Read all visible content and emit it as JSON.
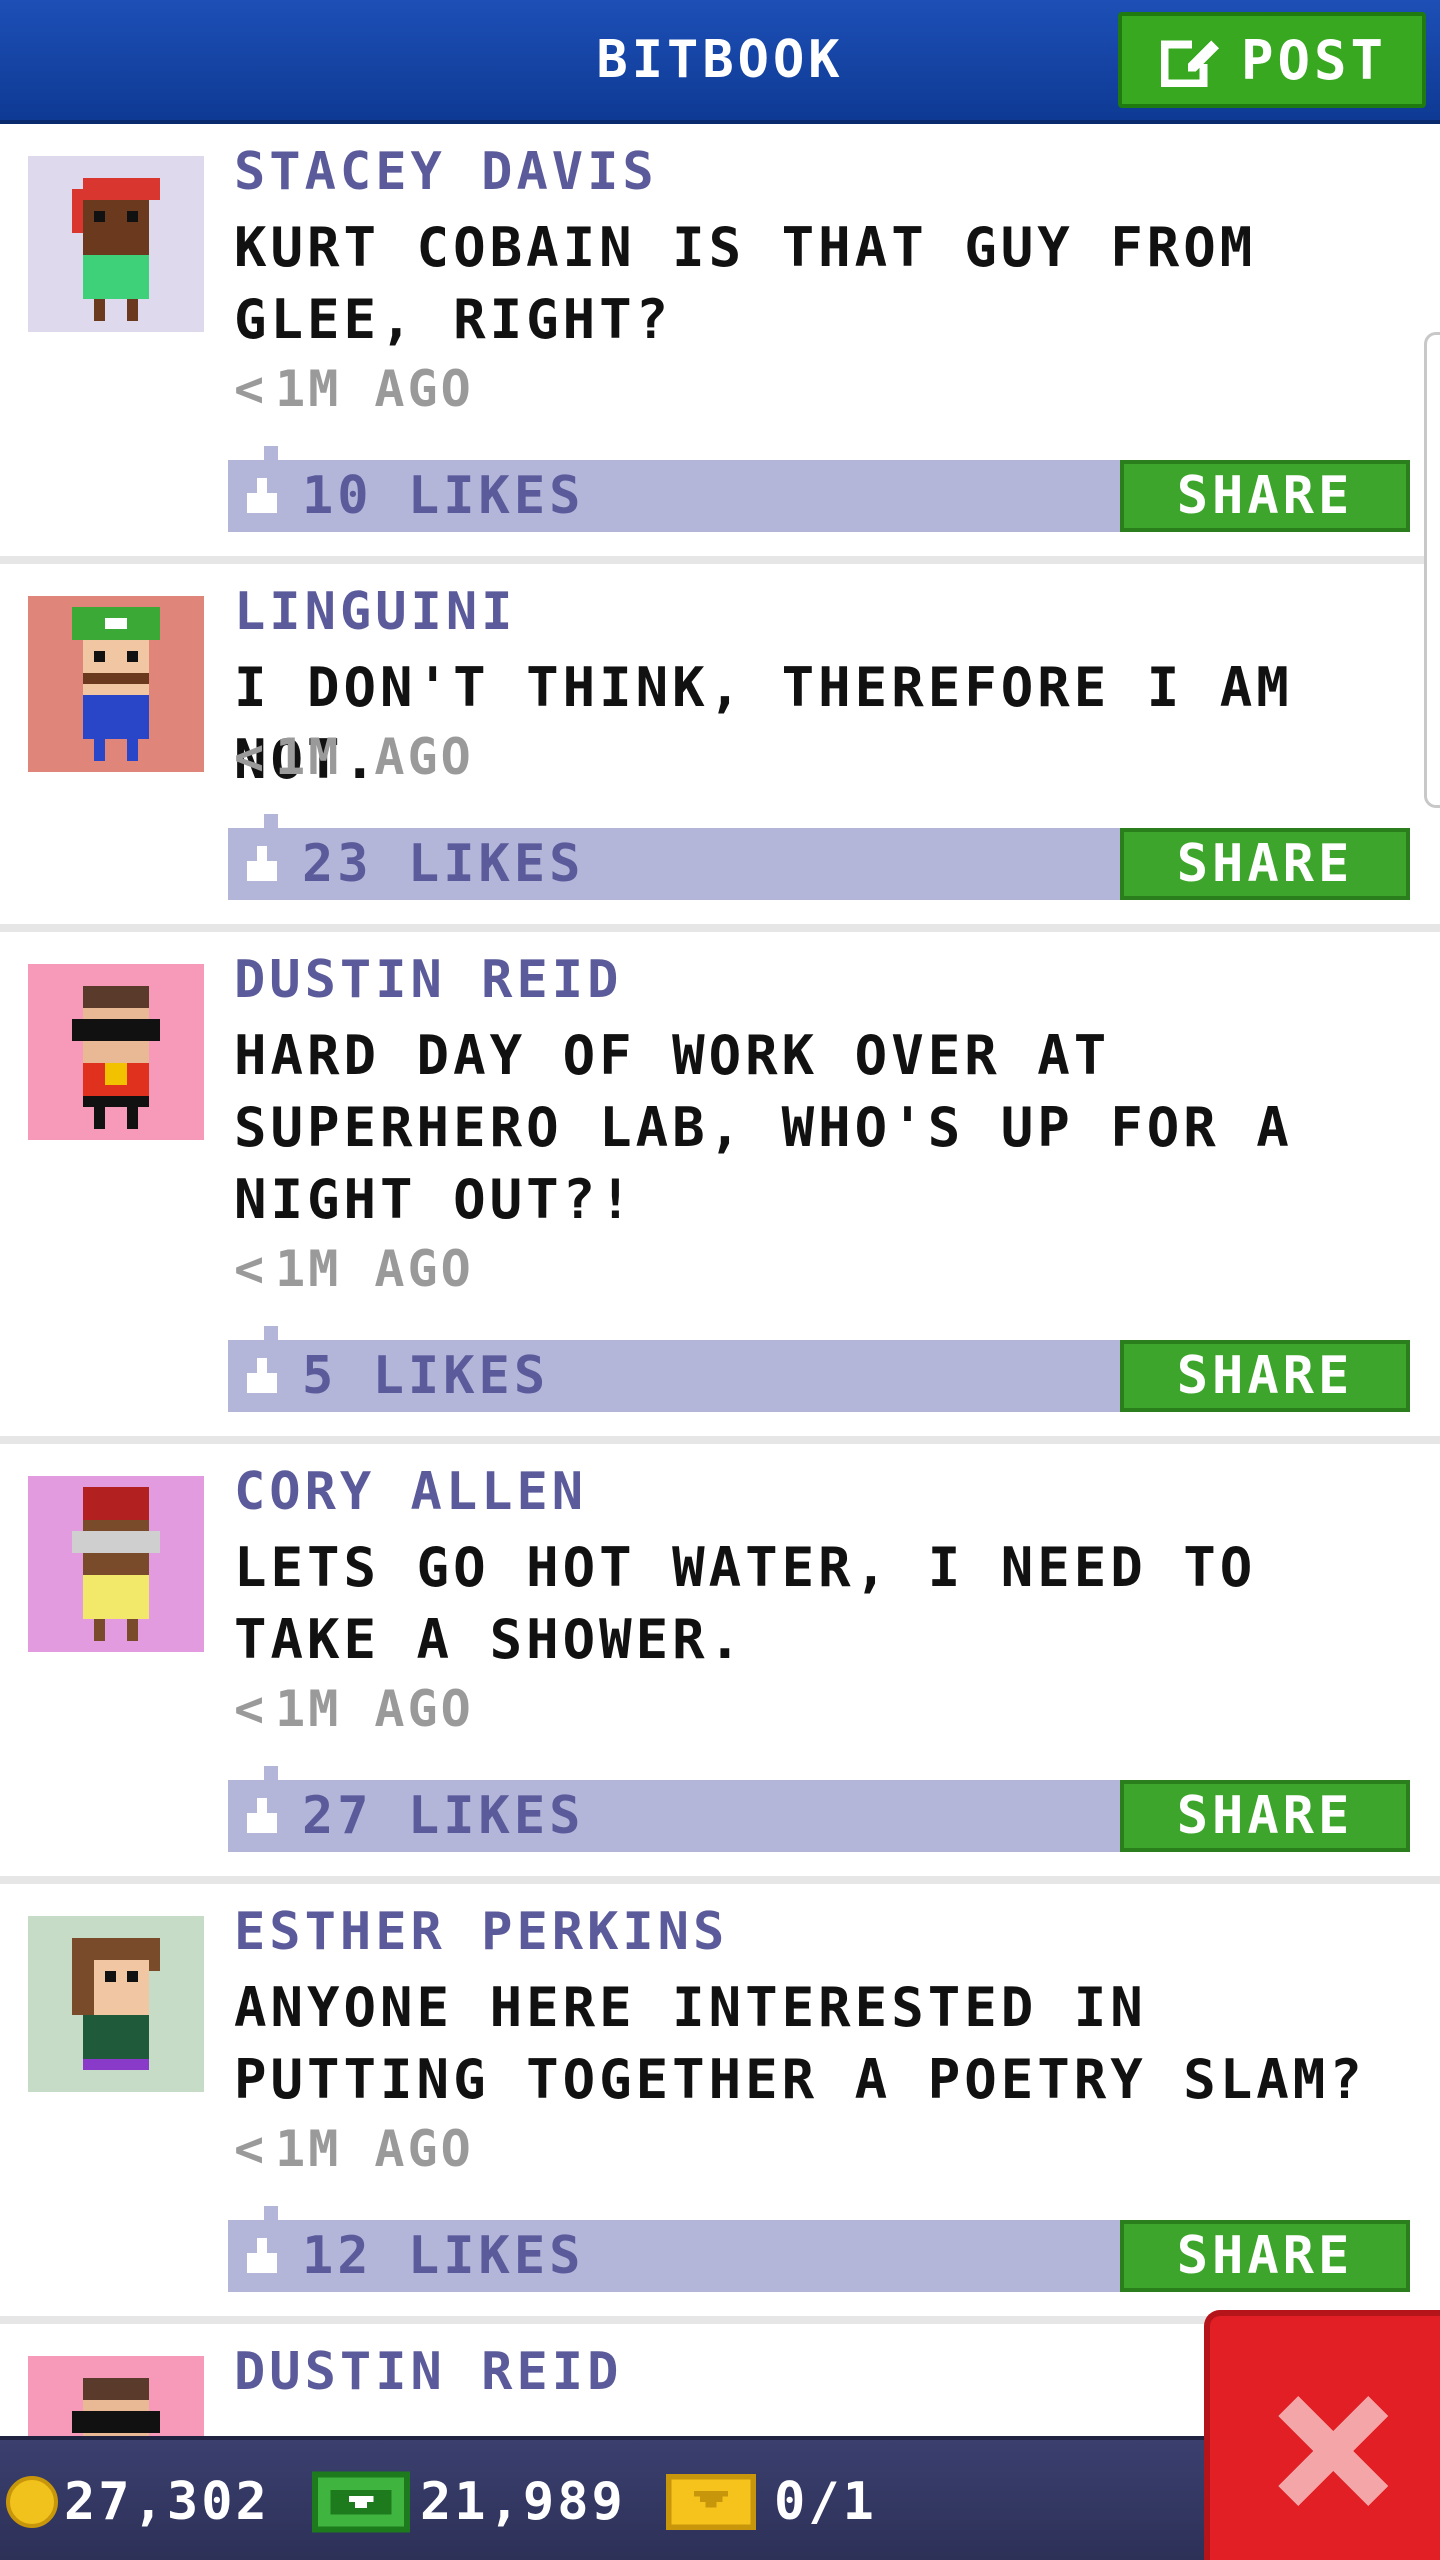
{
  "header": {
    "title": "BITBOOK",
    "post_label": "POST"
  },
  "colors": {
    "header": "#1d4fb6",
    "accent_green": "#3ea52c",
    "likes_bar": "#b3b5d9",
    "author": "#5b5b9b",
    "close_red": "#e11f25"
  },
  "posts": [
    {
      "author": "STACEY DAVIS",
      "message": "KURT COBAIN IS THAT GUY FROM GLEE, RIGHT?",
      "time": "1M AGO",
      "likes": "10 LIKES",
      "share": "SHARE",
      "avatar_bg": "#ded9ec",
      "avatar_icon": "avatar-stacey-davis-icon"
    },
    {
      "author": "LINGUINI",
      "message": "I DON'T THINK, THEREFORE I AM NOT.",
      "time": "1M AGO",
      "likes": "23 LIKES",
      "share": "SHARE",
      "avatar_bg": "#e0857a",
      "avatar_icon": "avatar-linguini-icon"
    },
    {
      "author": "DUSTIN REID",
      "message": "HARD DAY OF WORK OVER AT SUPERHERO LAB, WHO'S UP FOR A NIGHT OUT?!",
      "time": "1M AGO",
      "likes": "5 LIKES",
      "share": "SHARE",
      "avatar_bg": "#f79ab9",
      "avatar_icon": "avatar-dustin-reid-icon"
    },
    {
      "author": "CORY ALLEN",
      "message": "LETS GO HOT WATER, I NEED TO TAKE A SHOWER.",
      "time": "1M AGO",
      "likes": "27 LIKES",
      "share": "SHARE",
      "avatar_bg": "#e39be0",
      "avatar_icon": "avatar-cory-allen-icon"
    },
    {
      "author": "ESTHER PERKINS",
      "message": "ANYONE HERE INTERESTED IN PUTTING TOGETHER A POETRY SLAM?",
      "time": "1M AGO",
      "likes": "12 LIKES",
      "share": "SHARE",
      "avatar_bg": "#c7dcc6",
      "avatar_icon": "avatar-esther-perkins-icon"
    },
    {
      "author": "DUSTIN REID",
      "message": "",
      "time": "",
      "likes": "",
      "share": "",
      "avatar_bg": "#f79ab9",
      "avatar_icon": "avatar-dustin-reid-icon"
    }
  ],
  "stats": {
    "coins": "27,302",
    "bux": "21,989",
    "tickets": "0/1"
  }
}
